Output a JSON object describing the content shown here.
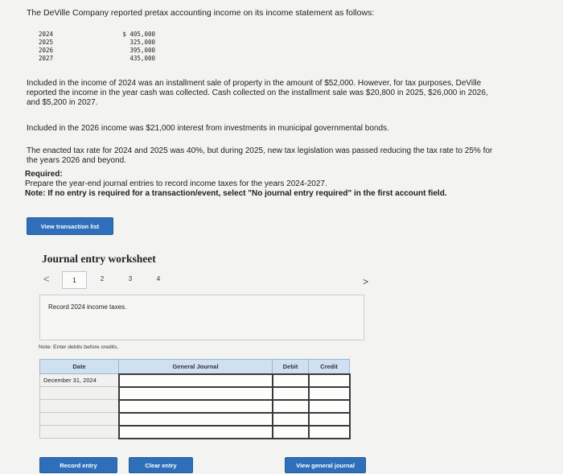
{
  "intro": "The DeVille Company reported pretax accounting income on its income statement as follows:",
  "income": [
    {
      "year": "2024",
      "amount": "$ 405,000"
    },
    {
      "year": "2025",
      "amount": "325,000"
    },
    {
      "year": "2026",
      "amount": "395,000"
    },
    {
      "year": "2027",
      "amount": "435,000"
    }
  ],
  "paragraph1_line1": "Included in the income of 2024 was an installment sale of property in the amount of $52,000. However, for tax purposes, DeVille",
  "paragraph1_line2": "reported the income in the year cash was collected. Cash collected on the installment sale was $20,800 in 2025, $26,000 in 2026,",
  "paragraph1_line3": "and $5,200 in 2027.",
  "paragraph2": "Included in the 2026 income was $21,000 interest from investments in municipal governmental bonds.",
  "paragraph3_line1": "The enacted tax rate for 2024 and 2025 was 40%, but during 2025, new tax legislation was passed reducing the tax rate to 25% for",
  "paragraph3_line2": "the years 2026 and beyond.",
  "required_label": "Required:",
  "required_text": "Prepare the year-end journal entries to record income taxes for the years 2024-2027.",
  "note_bold": "Note: If no entry is required for a transaction/event, select \"No journal entry required\" in the first account field.",
  "view_transaction_list": "View transaction list",
  "worksheet_title": "Journal entry worksheet",
  "pages": [
    "1",
    "2",
    "3",
    "4"
  ],
  "nav_prev": "<",
  "nav_next": ">",
  "record_prompt": "Record 2024 income taxes.",
  "note_debits": "Note: Enter debits before credits.",
  "table": {
    "headers": {
      "date": "Date",
      "account": "General Journal",
      "debit": "Debit",
      "credit": "Credit"
    },
    "first_date": "December 31, 2024"
  },
  "buttons": {
    "record": "Record entry",
    "clear": "Clear entry",
    "view_journal": "View general journal"
  }
}
